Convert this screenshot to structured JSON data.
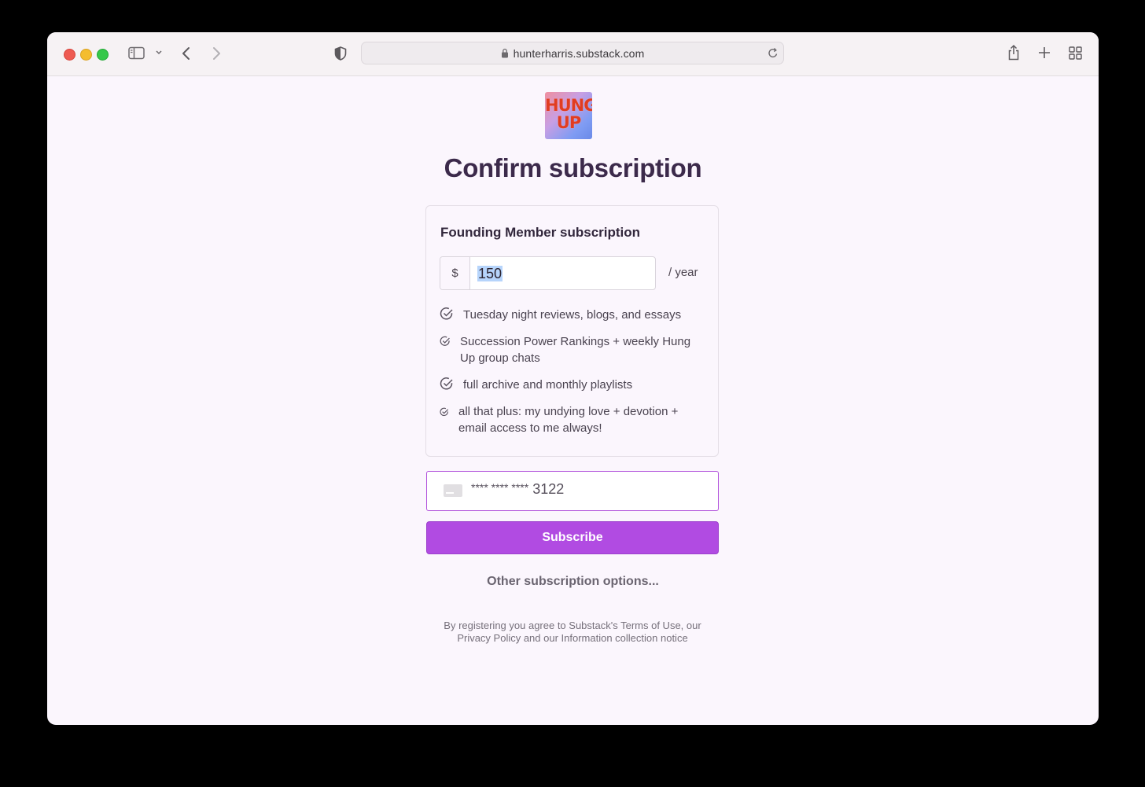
{
  "browser": {
    "url": "hunterharris.substack.com"
  },
  "logo": {
    "line1": "HUNG",
    "line2": "UP"
  },
  "page": {
    "title": "Confirm subscription"
  },
  "plan": {
    "title": "Founding Member subscription",
    "currency_symbol": "$",
    "price_value": "150",
    "period": "/ year",
    "features": [
      "Tuesday night reviews, blogs, and essays",
      "Succession Power Rankings + weekly Hung Up group chats",
      "full archive and monthly playlists",
      "all that plus: my undying love + devotion + email access to me always!"
    ]
  },
  "payment": {
    "card_mask": "**** **** ****",
    "card_last4": "3122"
  },
  "actions": {
    "subscribe_label": "Subscribe",
    "other_options_label": "Other subscription options..."
  },
  "legal": {
    "line1": "By registering you agree to Substack's Terms of Use, our",
    "line2": "Privacy Policy and our Information collection notice"
  },
  "colors": {
    "accent": "#b14be2",
    "title": "#3c2a4b",
    "page_background": "#fbf6fd"
  }
}
